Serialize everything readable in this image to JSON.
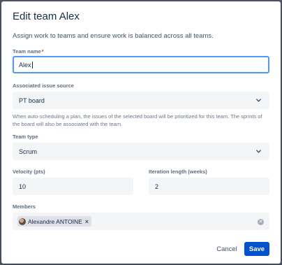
{
  "modal": {
    "title": "Edit team Alex",
    "description": "Assign work to teams and ensure work is balanced across all teams."
  },
  "team_name": {
    "label": "Team name",
    "required_marker": "*",
    "value": "Alex"
  },
  "issue_source": {
    "label": "Associated issue source",
    "selected": "PT board",
    "help": "When auto-scheduling a plan, the issues of the selected board will be prioritized for this team. The sprints of the board will also be associated with the team."
  },
  "team_type": {
    "label": "Team type",
    "selected": "Scrum"
  },
  "velocity": {
    "label": "Velocity (pts)",
    "value": "10"
  },
  "iteration": {
    "label": "Iteration length (weeks)",
    "value": "2"
  },
  "members": {
    "label": "Members",
    "chips": [
      {
        "name": "Alexandre ANTOINE",
        "remove": "×"
      }
    ],
    "clear_icon": "clear-icon"
  },
  "actions": {
    "cancel": "Cancel",
    "save": "Save"
  },
  "colors": {
    "primary": "#0052cc",
    "focus_border": "#4c9aff",
    "required": "#de350b"
  }
}
